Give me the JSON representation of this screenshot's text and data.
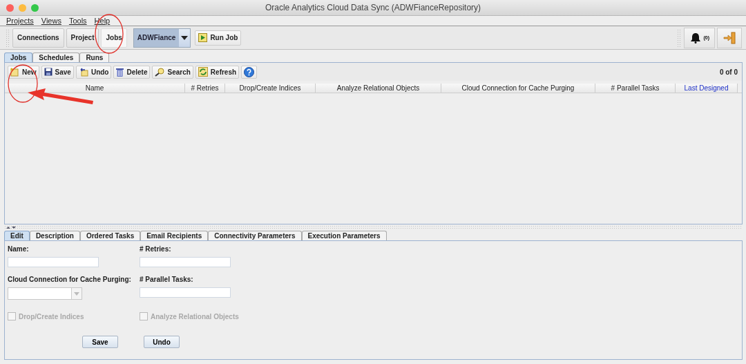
{
  "window": {
    "title": "Oracle Analytics Cloud Data Sync (ADWFianceRepository)"
  },
  "menu": [
    "Projects",
    "Views",
    "Tools",
    "Help"
  ],
  "nav_buttons": [
    {
      "label": "Connections",
      "selected": false
    },
    {
      "label": "Project",
      "selected": false
    },
    {
      "label": "Jobs",
      "selected": true
    }
  ],
  "project_selector": {
    "value": "ADWFiance"
  },
  "run_button": {
    "label": "Run Job"
  },
  "notifications": {
    "count": "(0)"
  },
  "main_tabs": [
    {
      "label": "Jobs",
      "selected": true
    },
    {
      "label": "Schedules",
      "selected": false
    },
    {
      "label": "Runs",
      "selected": false
    }
  ],
  "jobs_toolbar": [
    {
      "label": "New",
      "kind": "new"
    },
    {
      "label": "Save",
      "kind": "save"
    },
    {
      "label": "Undo",
      "kind": "undo"
    },
    {
      "label": "Delete",
      "kind": "delete"
    },
    {
      "label": "Search",
      "kind": "search"
    },
    {
      "label": "Refresh",
      "kind": "refresh"
    },
    {
      "kind": "help"
    }
  ],
  "record_count": "0 of 0",
  "table": {
    "columns": [
      {
        "label": "Name",
        "sorted": false
      },
      {
        "label": "# Retries",
        "sorted": false
      },
      {
        "label": "Drop/Create Indices",
        "sorted": false
      },
      {
        "label": "Analyze Relational Objects",
        "sorted": false
      },
      {
        "label": "Cloud Connection for Cache Purging",
        "sorted": false
      },
      {
        "label": "# Parallel Tasks",
        "sorted": false
      },
      {
        "label": "Last Designed",
        "sorted": true
      }
    ]
  },
  "detail_tabs": [
    {
      "label": "Edit",
      "selected": true
    },
    {
      "label": "Description",
      "selected": false
    },
    {
      "label": "Ordered Tasks",
      "selected": false
    },
    {
      "label": "Email Recipients",
      "selected": false
    },
    {
      "label": "Connectivity Parameters",
      "selected": false
    },
    {
      "label": "Execution Parameters",
      "selected": false
    }
  ],
  "form": {
    "fields": [
      {
        "label": "Name:",
        "kind": "text"
      },
      {
        "label": "# Retries:",
        "kind": "text"
      },
      {
        "label": "Cloud Connection for Cache Purging:",
        "kind": "combo"
      },
      {
        "label": "# Parallel Tasks:",
        "kind": "text"
      }
    ],
    "checkboxes": [
      {
        "label": "Drop/Create Indices",
        "checked": false,
        "disabled": true
      },
      {
        "label": "Analyze Relational Objects",
        "checked": false,
        "disabled": true
      }
    ],
    "buttons": [
      "Save",
      "Undo"
    ]
  },
  "annotations": [
    {
      "kind": "circle"
    },
    {
      "kind": "circle"
    },
    {
      "kind": "arrow"
    }
  ]
}
